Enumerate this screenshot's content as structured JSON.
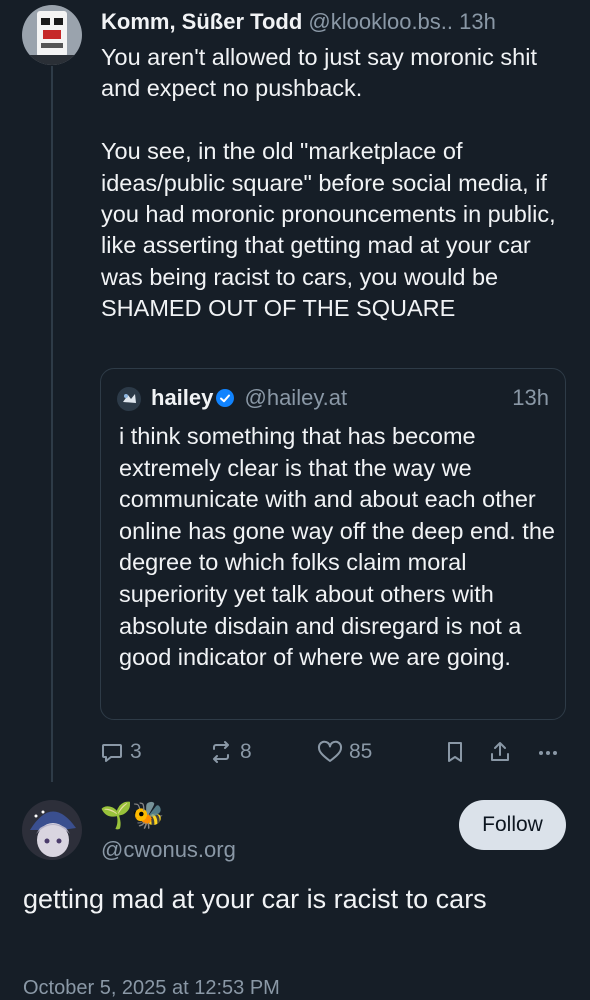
{
  "post1": {
    "author_name": "Komm, Süßer Todd",
    "handle": "@klookloo.bs..",
    "time": "13h",
    "text": "You aren't allowed to just say moronic shit and expect no pushback.\n\nYou see, in the old \"marketplace of ideas/public square\" before social media, if you had moronic pronouncements in public, like asserting that getting mad at your car was being racist to cars, you would be SHAMED OUT OF THE SQUARE",
    "avatar_icon": "robot-face-avatar",
    "quote": {
      "author_name": "hailey",
      "verified": true,
      "handle": "@hailey.at",
      "time": "13h",
      "text": "i think something that has become extremely clear is that the way we communicate with and about each other online has gone way off the deep end. the degree to which folks claim moral superiority yet talk about others with absolute disdain and disregard is not a good indicator of where we are going."
    },
    "actions": {
      "replies": "3",
      "reposts": "8",
      "likes": "85"
    }
  },
  "post2": {
    "display_name": "🌱🐝",
    "handle": "@cwonus.org",
    "follow_label": "Follow",
    "text": "getting mad at your car is racist to cars",
    "date": "October 5, 2025 at 12:53 PM",
    "avatar_icon": "anime-character-avatar"
  },
  "colors": {
    "background": "#161e27",
    "text": "#f1f3f5",
    "muted": "#8a98a6",
    "verified": "#1083fe",
    "follow_bg": "#dbe2ea"
  }
}
